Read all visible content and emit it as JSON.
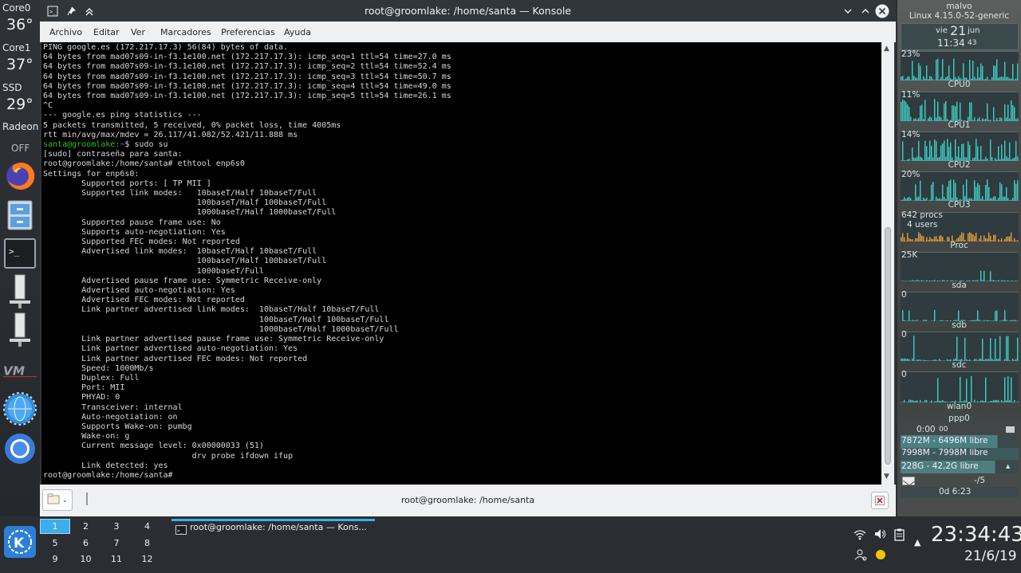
{
  "dock": {
    "sensors": [
      {
        "name": "Core0",
        "value": "36°"
      },
      {
        "name": "Core1",
        "value": "37°"
      },
      {
        "name": "SSD",
        "value": "29°"
      },
      {
        "name": "Radeon",
        "value": "OFF"
      }
    ],
    "icons": [
      "firefox-icon",
      "file-cabinet-icon",
      "terminal-icon",
      "server-icon",
      "server-icon",
      "vmware-icon",
      "settings-globe-icon",
      "chromium-icon"
    ]
  },
  "window": {
    "title": "root@groomlake: /home/santa — Konsole",
    "menu": [
      "Archivo",
      "Editar",
      "Ver",
      "Marcadores",
      "Preferencias",
      "Ayuda"
    ],
    "tab_title": "root@groomlake: /home/santa"
  },
  "terminal": {
    "lines": [
      "PING google.es (172.217.17.3) 56(84) bytes of data.",
      "64 bytes from mad07s09-in-f3.1e100.net (172.217.17.3): icmp_seq=1 ttl=54 time=27.0 ms",
      "64 bytes from mad07s09-in-f3.1e100.net (172.217.17.3): icmp_seq=2 ttl=54 time=52.4 ms",
      "64 bytes from mad07s09-in-f3.1e100.net (172.217.17.3): icmp_seq=3 ttl=54 time=50.7 ms",
      "64 bytes from mad07s09-in-f3.1e100.net (172.217.17.3): icmp_seq=4 ttl=54 time=49.0 ms",
      "64 bytes from mad07s09-in-f3.1e100.net (172.217.17.3): icmp_seq=5 ttl=54 time=26.1 ms",
      "^C",
      "--- google.es ping statistics ---",
      "5 packets transmitted, 5 received, 0% packet loss, time 4005ms",
      "rtt min/avg/max/mdev = 26.117/41.082/52.421/11.888 ms",
      "santa@groomlake:~$ sudo su",
      "[sudo] contraseña para santa:",
      "root@groomlake:/home/santa# ethtool enp6s0",
      "Settings for enp6s0:",
      "        Supported ports: [ TP MII ]",
      "        Supported link modes:   10baseT/Half 10baseT/Full",
      "                                100baseT/Half 100baseT/Full",
      "                                1000baseT/Half 1000baseT/Full",
      "        Supported pause frame use: No",
      "        Supports auto-negotiation: Yes",
      "        Supported FEC modes: Not reported",
      "        Advertised link modes:  10baseT/Half 10baseT/Full",
      "                                100baseT/Half 100baseT/Full",
      "                                1000baseT/Full",
      "        Advertised pause frame use: Symmetric Receive-only",
      "        Advertised auto-negotiation: Yes",
      "        Advertised FEC modes: Not reported",
      "        Link partner advertised link modes:  10baseT/Half 10baseT/Full",
      "                                             100baseT/Half 100baseT/Full",
      "                                             1000baseT/Half 1000baseT/Full",
      "        Link partner advertised pause frame use: Symmetric Receive-only",
      "        Link partner advertised auto-negotiation: Yes",
      "        Link partner advertised FEC modes: Not reported",
      "        Speed: 1000Mb/s",
      "        Duplex: Full",
      "        Port: MII",
      "        PHYAD: 0",
      "        Transceiver: internal",
      "        Auto-negotiation: on",
      "        Supports Wake-on: pumbg",
      "        Wake-on: g",
      "        Current message level: 0x00000033 (51)",
      "                               drv probe ifdown ifup",
      "        Link detected: yes",
      "root@groomlake:/home/santa#"
    ],
    "prompt_user": "santa@groomlake",
    "prompt_user_path": ":~",
    "prompt_user_rest": "$ sudo su"
  },
  "gkrellm": {
    "hostname": "malvo",
    "kernel": "Linux 4.15.0-52-generic",
    "day_name": "vie",
    "day_num": "21",
    "month": "jun",
    "time_hm": "11:34",
    "time_s": "43",
    "cpus": [
      {
        "label": "CPU0",
        "pct": "23%"
      },
      {
        "label": "CPU1",
        "pct": "11%"
      },
      {
        "label": "CPU2",
        "pct": "14%"
      },
      {
        "label": "CPU3",
        "pct": "20%"
      }
    ],
    "procs": "642 procs",
    "users": "4 users",
    "proc_label": "Proc",
    "disks": [
      {
        "label": "sda",
        "value": "25K"
      },
      {
        "label": "sdb",
        "value": "0"
      },
      {
        "label": "sdc",
        "value": "0"
      }
    ],
    "wlan_value": "0",
    "wlan_label": "wlan0",
    "ppp_label": "ppp0",
    "ppp_time": "0:00",
    "ppp_time2": "00",
    "mem": "7872M - 6496M libre",
    "swap": "7998M - 7998M libre",
    "fs": "228G - 42,2G libre",
    "mail": "-/5",
    "uptime": "0d  6:23"
  },
  "taskbar": {
    "desktops": [
      "1",
      "2",
      "3",
      "4",
      "5",
      "6",
      "7",
      "8",
      "9",
      "10",
      "11",
      "12"
    ],
    "active_desktop": "1",
    "task_title": "root@groomlake: /home/santa — Kons...",
    "clock_time": "23:34:43",
    "clock_date": "21/6/19"
  },
  "colors": {
    "terminal_bg": "#000000",
    "prompt_green": "#27c227",
    "taskbar_bg": "#2a2e32",
    "active_desktop": "#3daee9"
  }
}
